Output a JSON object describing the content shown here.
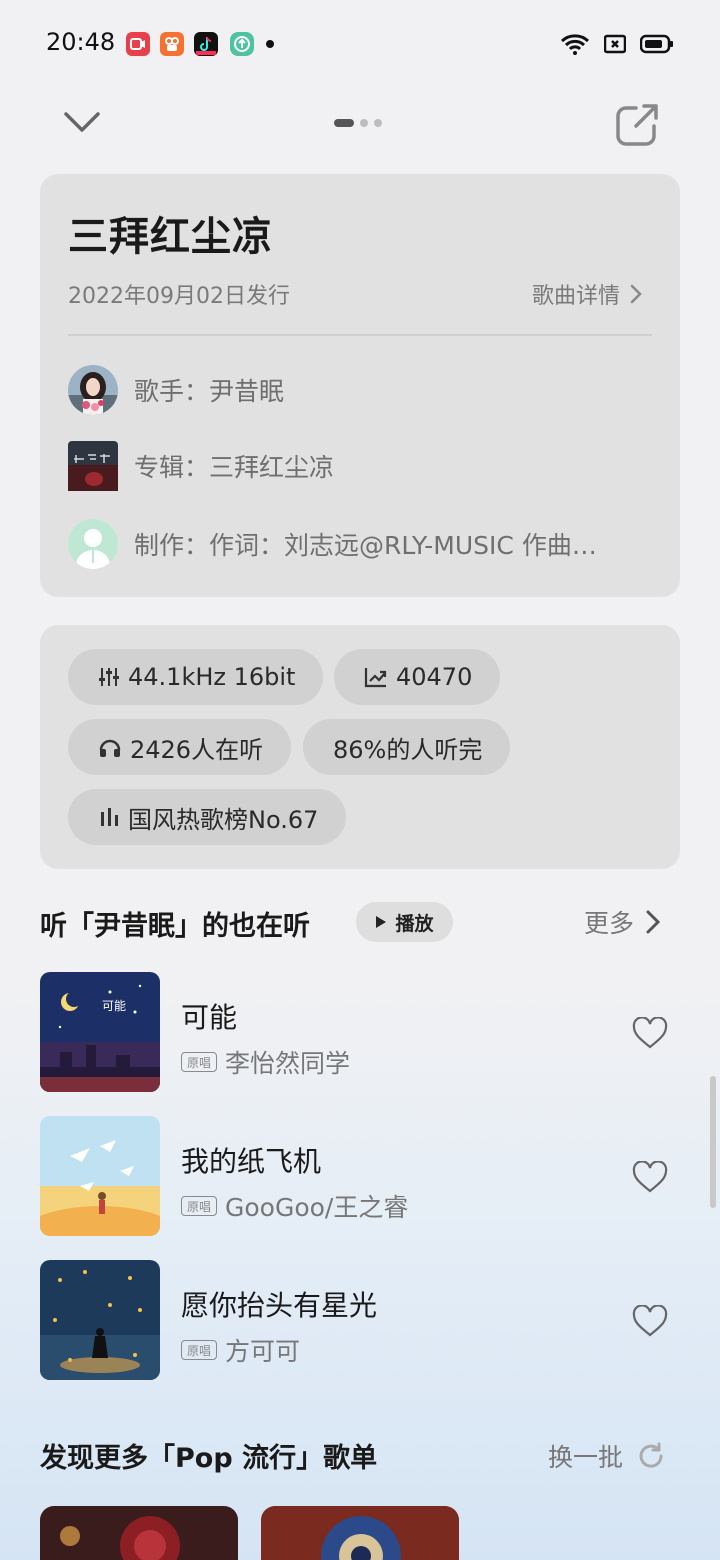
{
  "status_bar": {
    "time": "20:48",
    "app_icons": [
      "screen-record-icon",
      "kuaishou-icon",
      "tiktok-icon",
      "upload-icon"
    ]
  },
  "song": {
    "title": "三拜红尘凉",
    "release": "2022年09月02日发行",
    "detail_label": "歌曲详情"
  },
  "meta": {
    "singer": "歌手：尹昔眠",
    "album": "专辑：三拜红尘凉",
    "production": "制作：作词：刘志远@RLY-MUSIC  作曲…"
  },
  "stats": {
    "quality": "44.1kHz  16bit",
    "trend": "40470",
    "listeners": "2426人在听",
    "completion": "86%的人听完",
    "chart": "国风热歌榜No.67"
  },
  "similar": {
    "title": "听「尹昔眠」的也在听",
    "play_label": "播放",
    "more_label": "更多",
    "badge": "原唱",
    "songs": [
      {
        "name": "可能",
        "artist": "李怡然同学"
      },
      {
        "name": "我的纸飞机",
        "artist": "GooGoo/王之睿"
      },
      {
        "name": "愿你抬头有星光",
        "artist": "方可可"
      }
    ]
  },
  "discover": {
    "title": "发现更多「Pop 流行」歌单",
    "refresh_label": "换一批"
  },
  "colors": {
    "card": "#e1e1e1",
    "chip": "#d1d1d1",
    "muted_text": "#777777"
  }
}
